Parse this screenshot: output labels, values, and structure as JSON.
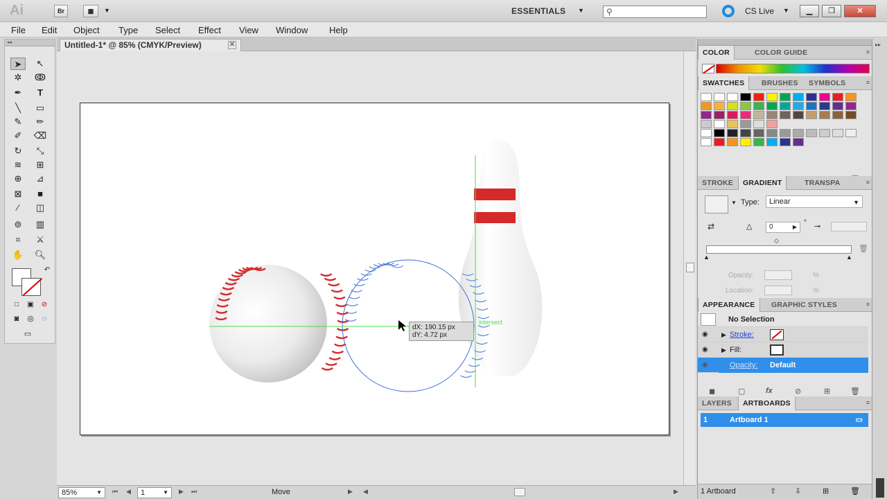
{
  "titlebar": {
    "app_logo": "Ai",
    "bridge_label": "Br",
    "workspace": "ESSENTIALS",
    "search_placeholder": "",
    "cs_live": "CS Live"
  },
  "menu": [
    "File",
    "Edit",
    "Object",
    "Type",
    "Select",
    "Effect",
    "View",
    "Window",
    "Help"
  ],
  "document": {
    "tab_title": "Untitled-1* @ 85% (CMYK/Preview)",
    "tooltip_dx": "dX: 190.15 px",
    "tooltip_dy": "dY: 4.72 px",
    "smart_guide": "intersect"
  },
  "statusbar": {
    "zoom": "85%",
    "artboard_num": "1",
    "tool_status": "Move"
  },
  "panels": {
    "color_tabs": [
      "COLOR",
      "COLOR GUIDE"
    ],
    "swatch_tabs": [
      "SWATCHES",
      "BRUSHES",
      "SYMBOLS"
    ],
    "gradient_tabs": [
      "STROKE",
      "GRADIENT",
      "TRANSPA"
    ],
    "gradient": {
      "type_label": "Type:",
      "type_value": "Linear",
      "angle": "0",
      "angle_unit": "°",
      "opacity_label": "Opacity:",
      "location_label": "Location:",
      "percent": "%"
    },
    "appearance_tabs": [
      "APPEARANCE",
      "GRAPHIC STYLES"
    ],
    "appearance": {
      "selection": "No Selection",
      "stroke": "Stroke:",
      "fill": "Fill:",
      "opacity": "Opacity:",
      "opacity_value": "Default"
    },
    "layers_tabs": [
      "LAYERS",
      "ARTBOARDS"
    ],
    "artboards": {
      "row_num": "1",
      "row_name": "Artboard 1",
      "footer": "1 Artboard"
    }
  },
  "colors": {
    "accent": "#2f8fea",
    "seam_red": "#d42a2a",
    "outline_blue": "#3c6fd8",
    "guide_green": "#4adc4a"
  },
  "icons": [
    "search-icon",
    "cs-live-icon",
    "eye-icon",
    "trash-icon",
    "new-swatch-icon"
  ]
}
